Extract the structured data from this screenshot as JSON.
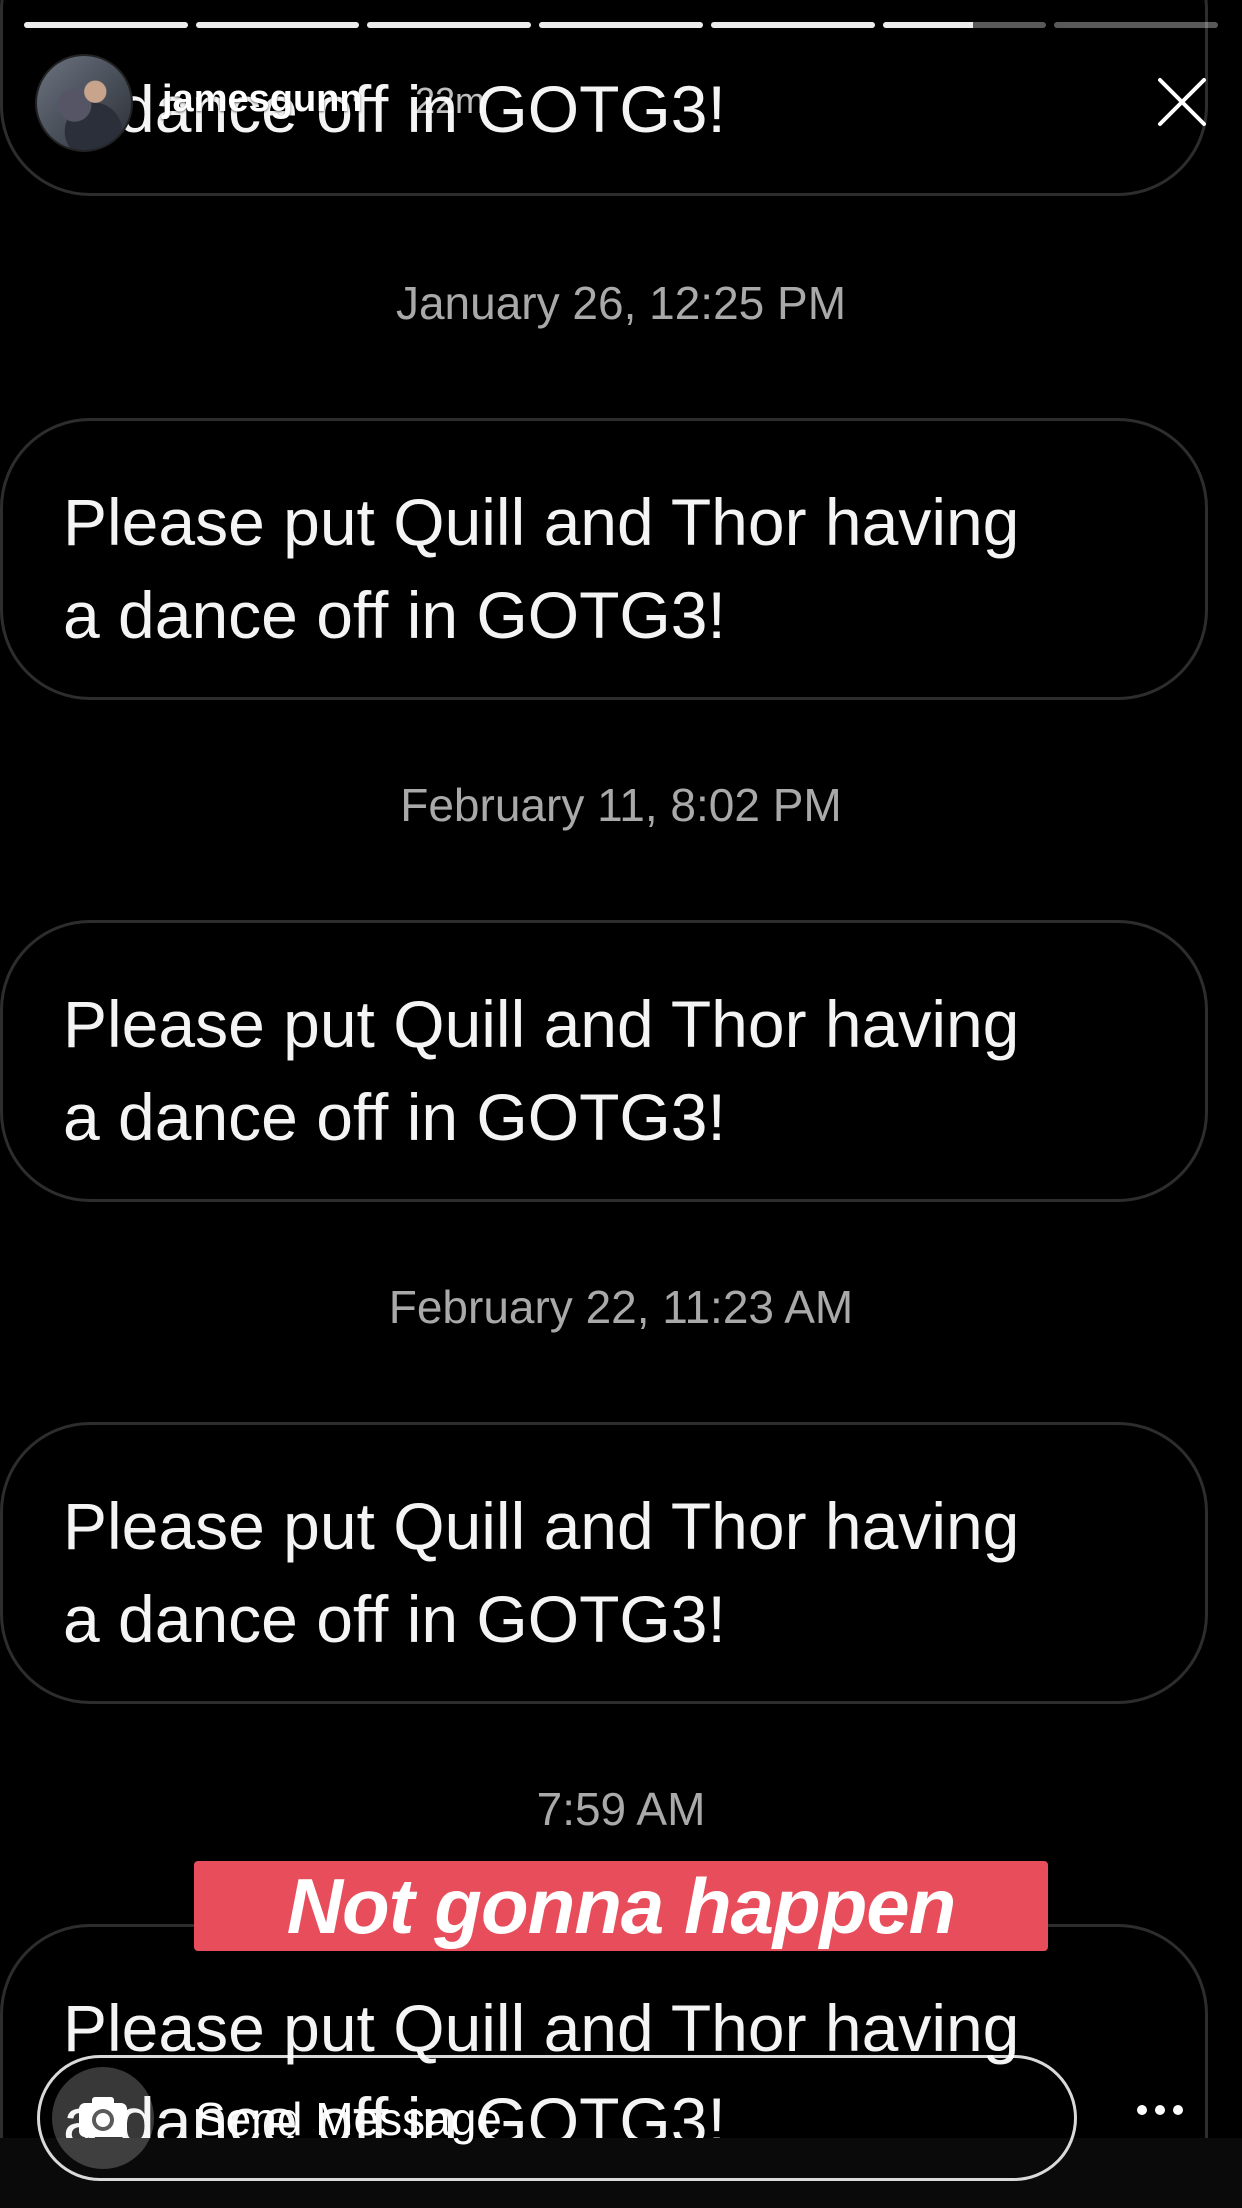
{
  "story": {
    "progress_segments": [
      1,
      1,
      1,
      1,
      1,
      0.55,
      0
    ],
    "username": "jamesgunn",
    "time_ago": "22m"
  },
  "chat": {
    "top_partial_text": "a dance off in GOTG3!",
    "messages": [
      {
        "timestamp": "January 26, 12:25 PM",
        "line1": "Please put Quill and Thor having",
        "line2": "a dance off in GOTG3!"
      },
      {
        "timestamp": "February 11, 8:02 PM",
        "line1": "Please put Quill and Thor having",
        "line2": "a dance off in GOTG3!"
      },
      {
        "timestamp": "February 22, 11:23 AM",
        "line1": "Please put Quill and Thor having",
        "line2": "a dance off in GOTG3!"
      },
      {
        "timestamp": "7:59 AM",
        "line1": "Please put Quill and Thor having",
        "line2": "a dance off in GOTG3!"
      }
    ]
  },
  "sticker": {
    "text": "Not gonna happen",
    "color": "#e84d5b"
  },
  "bottom_bar": {
    "placeholder": "Send Message",
    "camera_icon": "camera-icon",
    "more_icon": "more-horizontal-icon",
    "close_icon": "close-icon"
  }
}
